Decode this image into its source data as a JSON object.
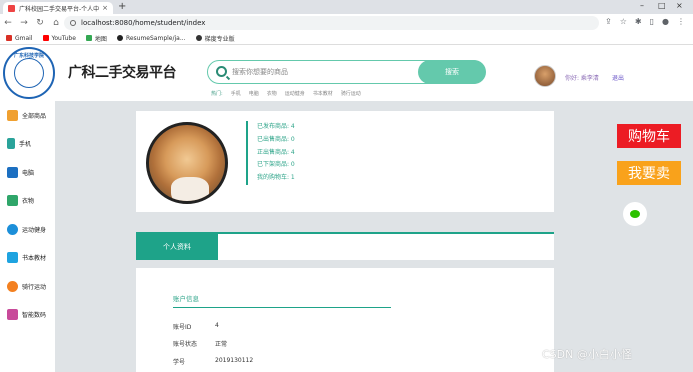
{
  "browser": {
    "tab_title": "广科校园二手交易平台-个人中心",
    "url": "localhost:8080/home/student/index",
    "bookmarks": [
      {
        "label": "Gmail",
        "color": "#d93025"
      },
      {
        "label": "YouTube",
        "color": "#ff0000"
      },
      {
        "label": "地图",
        "color": "#34a853"
      },
      {
        "label": "ResumeSample/ja...",
        "color": "#222222"
      },
      {
        "label": "梯度专业版",
        "color": "#333333"
      }
    ]
  },
  "header": {
    "logo_text": "广东科技学院",
    "brand": "广科二手交易平台",
    "search_placeholder": "搜索你想要的商品",
    "search_button": "搜索",
    "hot_label": "热门:",
    "hot_tags": [
      "手机",
      "电脑",
      "衣物",
      "运动健身",
      "书本教材",
      "骑行运动"
    ],
    "greeting": "你好: 乘李清",
    "logout": "退出"
  },
  "sidebar": {
    "items": [
      {
        "label": "全部商品",
        "color": "#f0a030"
      },
      {
        "label": "手机",
        "color": "#2aa39a"
      },
      {
        "label": "电脑",
        "color": "#1c6fc1"
      },
      {
        "label": "衣物",
        "color": "#2fa66a"
      },
      {
        "label": "运动健身",
        "color": "#1c8fd9"
      },
      {
        "label": "书本教材",
        "color": "#1ea3e0"
      },
      {
        "label": "骑行运动",
        "color": "#f38020"
      },
      {
        "label": "智能数码",
        "color": "#c84a9a"
      }
    ]
  },
  "profile": {
    "stats": [
      "已发布商品: 4",
      "已出售商品: 0",
      "正出售商品: 4",
      "已下架商品: 0",
      "我的购物车: 1"
    ]
  },
  "tabs": {
    "active": "个人资料"
  },
  "account": {
    "section_title": "账户信息",
    "rows": [
      {
        "key": "账号ID",
        "value": "4"
      },
      {
        "key": "账号状态",
        "value": "正常"
      },
      {
        "key": "学号",
        "value": "2019130112"
      }
    ]
  },
  "floating": {
    "cart": "购物车",
    "sell": "我要卖"
  },
  "watermark": "CSDN @小白小怪"
}
